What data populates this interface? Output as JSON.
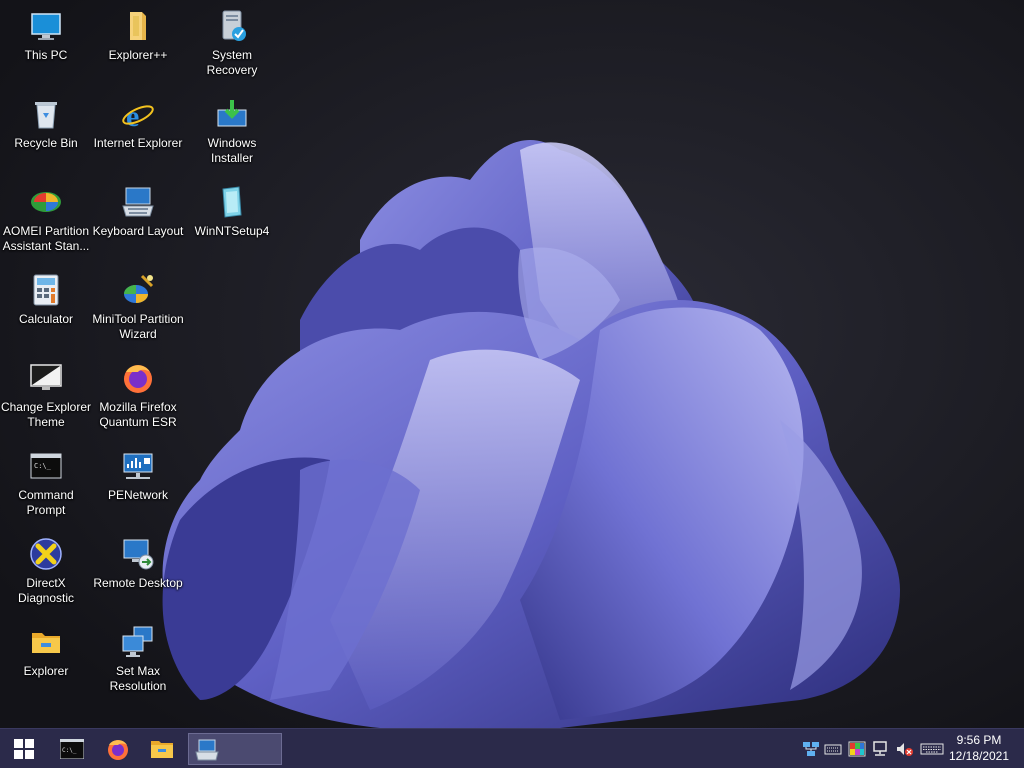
{
  "desktop": {
    "icons": [
      {
        "label": "This PC",
        "icon": "monitor-icon"
      },
      {
        "label": "Recycle Bin",
        "icon": "recycle-bin-icon"
      },
      {
        "label": "AOMEI Partition Assistant Stan...",
        "icon": "aomei-icon"
      },
      {
        "label": "Calculator",
        "icon": "calculator-icon"
      },
      {
        "label": "Change Explorer Theme",
        "icon": "theme-icon"
      },
      {
        "label": "Command Prompt",
        "icon": "cmd-icon"
      },
      {
        "label": "DirectX Diagnostic",
        "icon": "directx-icon"
      },
      {
        "label": "Explorer",
        "icon": "folder-icon"
      },
      {
        "label": "Explorer++",
        "icon": "folder-icon"
      },
      {
        "label": "Internet Explorer",
        "icon": "ie-icon"
      },
      {
        "label": "Keyboard Layout",
        "icon": "keyboard-icon"
      },
      {
        "label": "MiniTool Partition Wizard",
        "icon": "minitool-icon"
      },
      {
        "label": "Mozilla Firefox Quantum ESR",
        "icon": "firefox-icon"
      },
      {
        "label": "PENetwork",
        "icon": "network-icon"
      },
      {
        "label": "Remote Desktop",
        "icon": "remote-desktop-icon"
      },
      {
        "label": "Set Max Resolution",
        "icon": "display-icon"
      },
      {
        "label": "System Recovery",
        "icon": "system-recovery-icon"
      },
      {
        "label": "Windows Installer",
        "icon": "installer-icon"
      },
      {
        "label": "WinNTSetup4",
        "icon": "winntsetup-icon"
      }
    ]
  },
  "taskbar": {
    "start": "windows-start-icon",
    "pinned": [
      "cmd-icon",
      "firefox-icon",
      "folder-icon",
      "keyboard-layout-icon"
    ],
    "tray": [
      "network-settings-icon",
      "keyboard-icon",
      "color-icon",
      "network-icon",
      "volume-muted-icon",
      "keyboard-input-icon"
    ],
    "clock": {
      "time": "9:56 PM",
      "date": "12/18/2021"
    }
  },
  "colors": {
    "taskbar": "#2b2a4a",
    "wallpaper": "#1b1b20",
    "bloom": "#5a5bb8"
  }
}
